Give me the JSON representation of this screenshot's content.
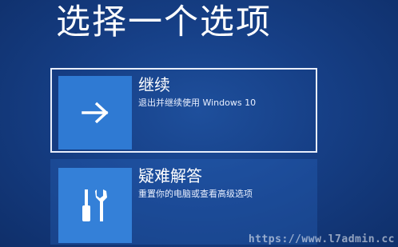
{
  "screen": {
    "title": "选择一个选项"
  },
  "options": [
    {
      "label": "继续",
      "description": "退出并继续使用 Windows 10",
      "icon": "arrow-right-icon"
    },
    {
      "label": "疑难解答",
      "description": "重置你的电脑或查看高级选项",
      "icon": "tools-icon"
    }
  ],
  "watermark": {
    "text": "https://www.l7admin.cc"
  },
  "colors": {
    "background": "#163f86",
    "tile": "#2f7ad3",
    "text": "#ffffff"
  }
}
